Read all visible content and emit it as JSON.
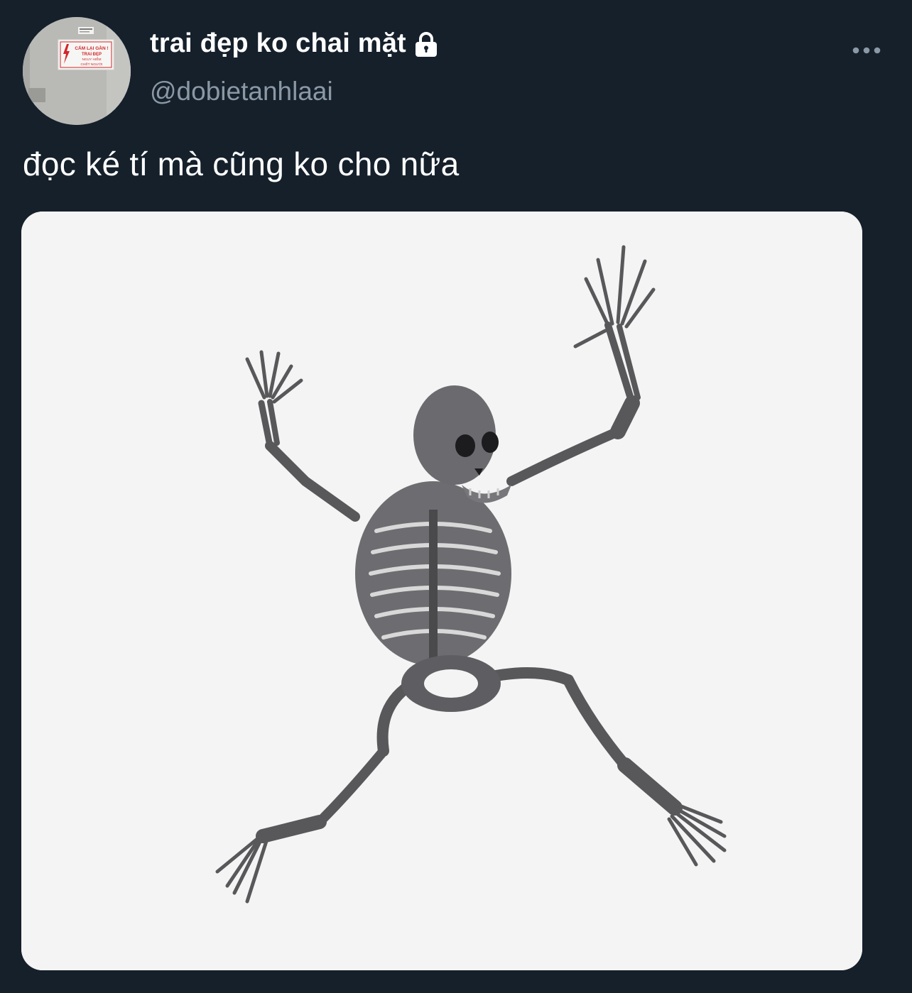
{
  "tweet": {
    "display_name": "trai đẹp ko chai mặt",
    "handle": "@dobietanhlaai",
    "text": "đọc ké tí mà cũng ko cho nữa",
    "protected_icon": "lock-icon",
    "more_icon": "more-horizontal-icon"
  },
  "avatar": {
    "sign_lines": [
      "CẤM LẠI GẦN !",
      "TRAI ĐẸP",
      "NGUY HIỂM",
      "CHẾT NGƯỜI"
    ],
    "accent": "#d3262a"
  },
  "media": {
    "subject": "skeleton-image",
    "background": "#f4f4f4"
  },
  "colors": {
    "background": "#15202b",
    "primary_text": "#ffffff",
    "secondary_text": "#8b98a5"
  }
}
